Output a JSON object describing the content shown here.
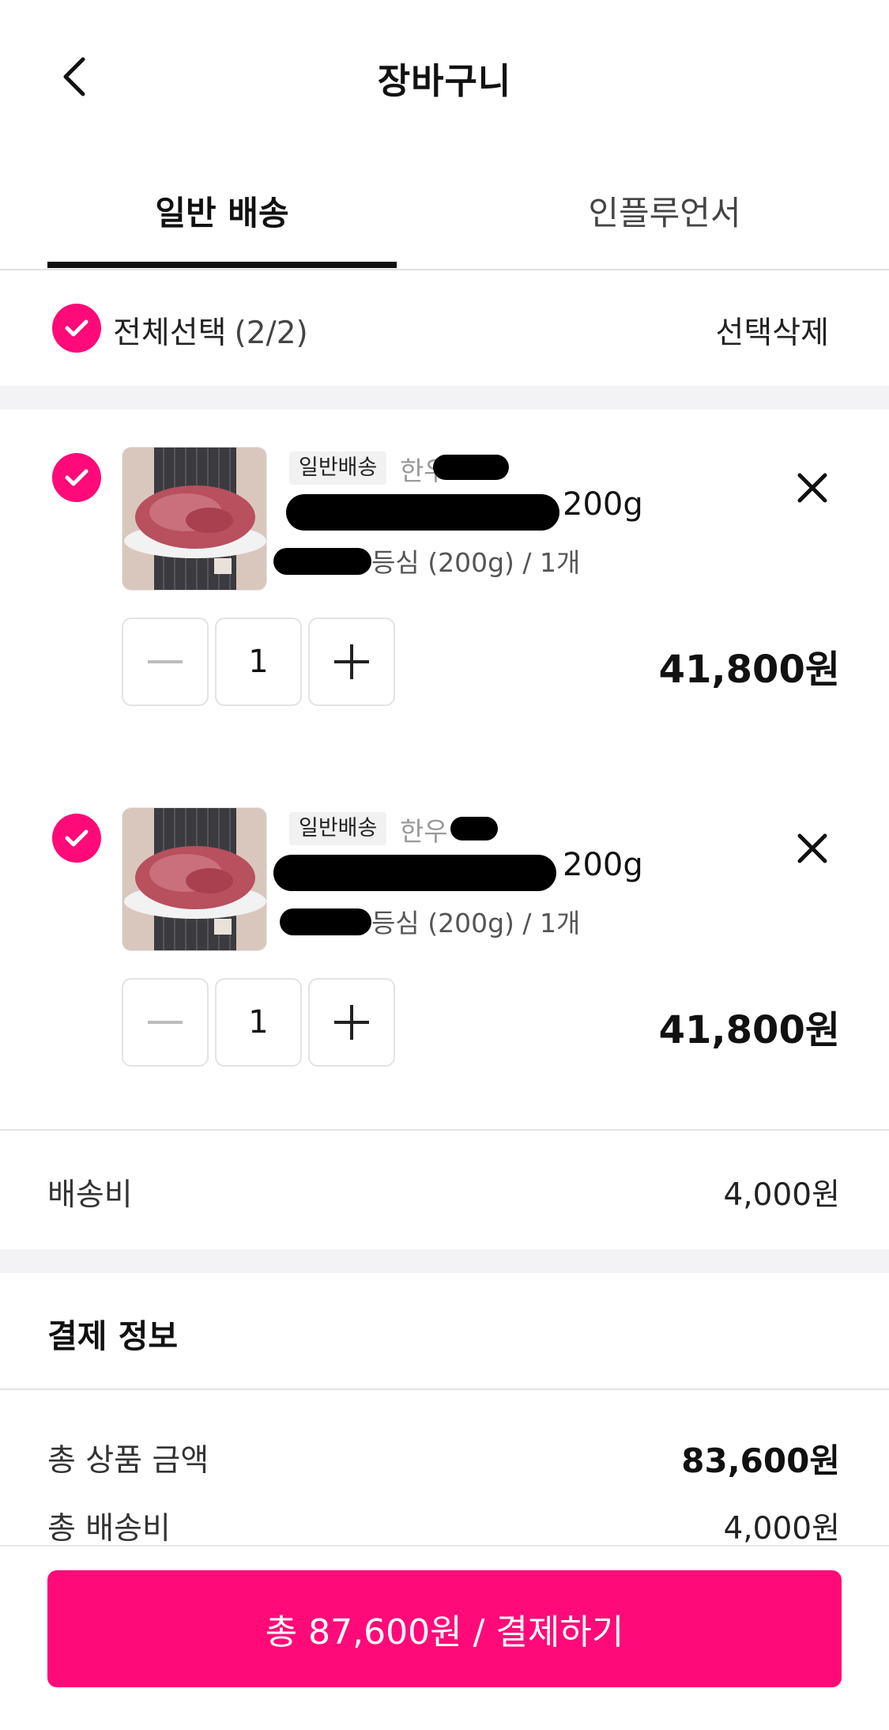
{
  "header": {
    "title": "장바구니"
  },
  "tabs": [
    {
      "label": "일반 배송",
      "active": true
    },
    {
      "label": "인플루언서",
      "active": false
    }
  ],
  "select_all": {
    "label": "전체선택",
    "count": "(2/2)",
    "delete_label": "선택삭제",
    "checked": true
  },
  "items": [
    {
      "checked": true,
      "tag": "일반배송",
      "brand": "한우",
      "name": "200g",
      "option": "등심 (200g) / 1개",
      "quantity": "1",
      "price": "41,800원"
    },
    {
      "checked": true,
      "tag": "일반배송",
      "brand": "한우",
      "name": "200g",
      "option": "등심 (200g) / 1개",
      "quantity": "1",
      "price": "41,800원"
    }
  ],
  "shipping": {
    "label": "배송비",
    "value": "4,000원"
  },
  "payment": {
    "title": "결제 정보",
    "total_products_label": "총 상품 금액",
    "total_products_value": "83,600원",
    "total_shipping_label": "총 배송비",
    "total_shipping_value": "4,000원"
  },
  "pay_button": {
    "label": "총 87,600원 / 결제하기"
  },
  "colors": {
    "accent": "#ff0a78",
    "divider": "#f3f3f6"
  },
  "icons": [
    "back-arrow-icon",
    "check-icon",
    "close-icon",
    "minus-icon",
    "plus-icon"
  ]
}
